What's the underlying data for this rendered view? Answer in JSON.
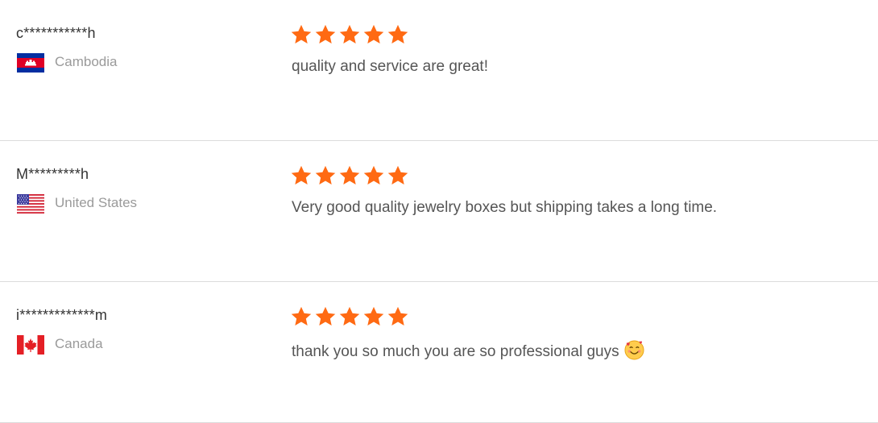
{
  "star_color": "#ff6a13",
  "reviews": [
    {
      "reviewer": "c***********h",
      "country": "Cambodia",
      "flag_icon": "cambodia-flag-icon",
      "rating": 5,
      "comment": "quality and service are great!"
    },
    {
      "reviewer": "M*********h",
      "country": "United States",
      "flag_icon": "united-states-flag-icon",
      "rating": 5,
      "comment": "Very good quality jewelry boxes but shipping takes a long time."
    },
    {
      "reviewer": "i*************m",
      "country": "Canada",
      "flag_icon": "canada-flag-icon",
      "rating": 5,
      "comment": "thank you so much you are so professional guys",
      "emoji_icon": "smiling-face-with-hearts-icon"
    }
  ]
}
